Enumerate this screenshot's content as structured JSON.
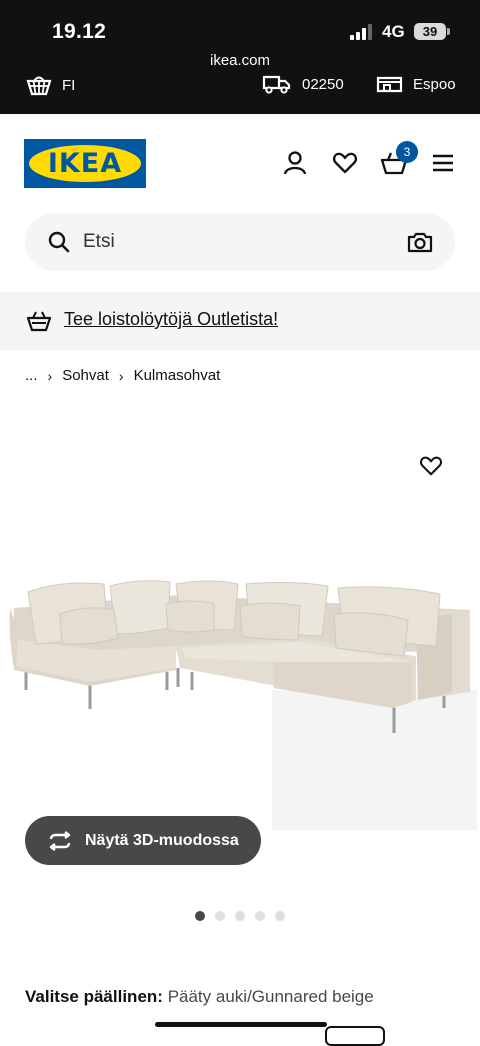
{
  "status_bar": {
    "time": "19.12",
    "network": "4G",
    "battery": "39",
    "url": "ikea.com",
    "language": "FI",
    "postal_code": "02250",
    "store": "Espoo"
  },
  "header": {
    "logo_text": "IKEA",
    "cart_count": "3",
    "icons": [
      "user-icon",
      "heart-icon",
      "cart-icon",
      "menu-icon"
    ]
  },
  "search": {
    "placeholder": "Etsi"
  },
  "promo": {
    "text": "Tee loistolöytöjä Outletista!"
  },
  "breadcrumb": {
    "items": [
      "...",
      "Sohvat",
      "Kulmasohvat"
    ]
  },
  "product": {
    "view_3d_label": "Näytä 3D-muodossa",
    "image_count": 5,
    "active_image": 1,
    "cover_label": "Valitse päällinen:",
    "cover_value": "Pääty auki/Gunnared beige"
  },
  "colors": {
    "ikea_blue": "#0058a3",
    "ikea_yellow": "#ffdb00",
    "dark_button": "#484848"
  }
}
